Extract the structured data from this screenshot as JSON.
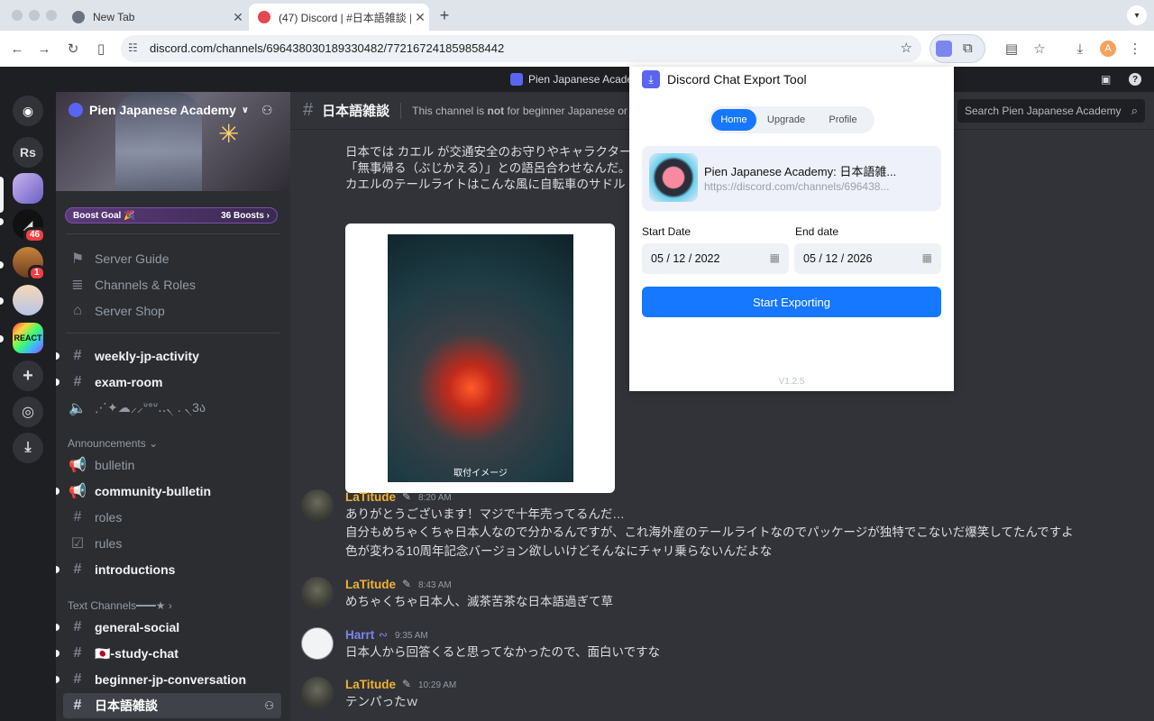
{
  "browser": {
    "tabs": [
      {
        "title": "New Tab",
        "active": false
      },
      {
        "title": "(47) Discord | #日本語雑談 | Pi",
        "active": true
      }
    ],
    "url": "discord.com/channels/696438030189330482/772167241859858442",
    "profile_initial": "A"
  },
  "discord": {
    "window_title": "Pien Japanese Academy",
    "guilds": [
      {
        "label": "Rs"
      },
      {
        "badge": "46"
      },
      {
        "badge": "1"
      },
      {
        "label": "REACT"
      }
    ],
    "server": {
      "name": "Pien Japanese Academy",
      "boost_goal": "Boost Goal 🎉",
      "boosts": "36 Boosts"
    },
    "nav_items": [
      "Server Guide",
      "Channels & Roles",
      "Server Shop"
    ],
    "channels_top": [
      "weekly-jp-activity",
      "exam-room",
      "⋰✦☁︎⸝⸝ᐡᐤᐡ‥৲ . ৲3ა"
    ],
    "category_announcements": "Announcements",
    "announcement_channels": [
      "bulletin",
      "community-bulletin",
      "roles",
      "rules",
      "introductions"
    ],
    "category_text": "Text Channels━━━★",
    "text_channels": [
      "general-social",
      "🇯🇵-study-chat",
      "beginner-jp-conversation",
      "日本語雑談"
    ],
    "channel": {
      "name": "日本語雑談",
      "topic_prefix": "This channel is ",
      "topic_bold": "not",
      "topic_suffix": " for beginner Japanese or Eng",
      "search_placeholder": "Search Pien Japanese Academy"
    },
    "top_message": {
      "lines": [
        "日本では カエル が交通安全のお守りやキャラクター",
        "「無事帰る（ぶじかえる）」との語呂合わせなんだ。",
        "カエルのテールライトはこんな風に自転車のサドル"
      ],
      "image_caption": "取付イメージ"
    },
    "messages": [
      {
        "author": "LaTitude",
        "author_color": "#f0b232",
        "time": "8:20 AM",
        "lines": [
          "ありがとうございます！マジで十年売ってるんだ…",
          "自分もめちゃくちゃ日本人なので分かるんですが、これ海外産のテールライトなのでパッケージが独特でこないだ爆笑してたんですよ",
          "色が変わる10周年記念バージョン欲しいけどそんなにチャリ乗らないんだよな"
        ]
      },
      {
        "author": "LaTitude",
        "author_color": "#f0b232",
        "time": "8:43 AM",
        "lines": [
          "めちゃくちゃ日本人、滅茶苦茶な日本語過ぎて草"
        ]
      },
      {
        "author": "Harrt",
        "author_color": "#7b86ee",
        "time": "9:35 AM",
        "lines": [
          "日本人から回答くると思ってなかったので、面白いですな"
        ]
      },
      {
        "author": "LaTitude",
        "author_color": "#f0b232",
        "time": "10:29 AM",
        "lines": [
          "テンパったｗ"
        ]
      }
    ]
  },
  "extension": {
    "title": "Discord Chat Export Tool",
    "tabs": [
      "Home",
      "Upgrade",
      "Profile"
    ],
    "active_tab": "Home",
    "server_title": "Pien Japanese Academy: 日本語雑...",
    "server_url": "https://discord.com/channels/696438...",
    "start_label": "Start Date",
    "end_label": "End date",
    "start_date": "05 / 12 / 2022",
    "end_date": "05 / 12 / 2026",
    "export_button": "Start Exporting",
    "version": "V1.2.5"
  }
}
